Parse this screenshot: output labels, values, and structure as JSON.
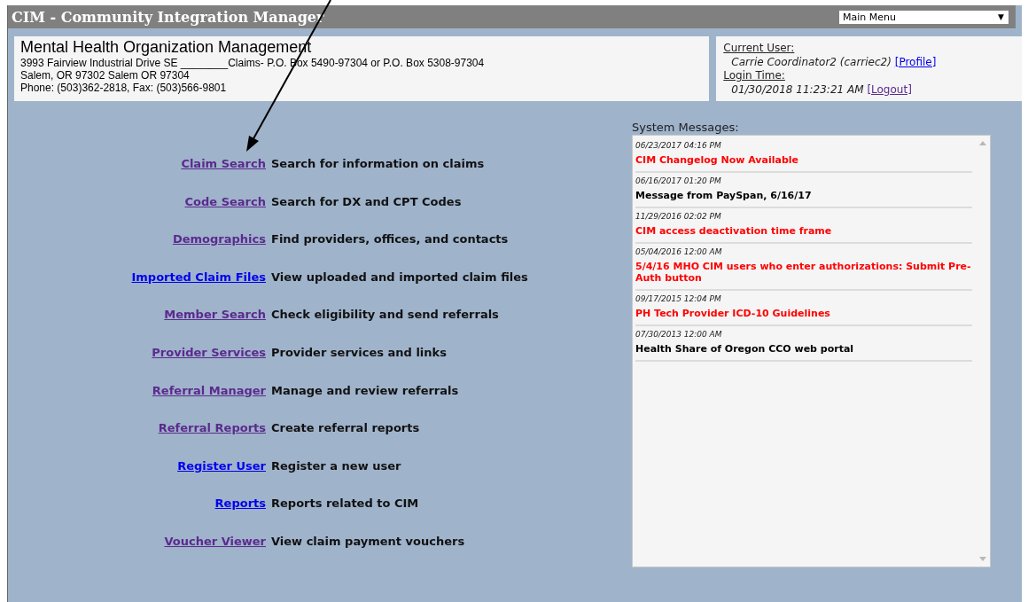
{
  "window": {
    "title": "CIM - Community Integration Manager"
  },
  "menu": {
    "value": "Main Menu",
    "arrow": "▼"
  },
  "organization": {
    "name": "Mental Health Organization Management",
    "address_lines": [
      "3993 Fairview Industrial Drive SE ________Claims- P.O. Box 5490-97304 or P.O. Box 5308-97304",
      "Salem, OR 97302 Salem OR 97304",
      "Phone: (503)362-2818, Fax: (503)566-9801"
    ]
  },
  "user": {
    "user_label": "Current User:",
    "user_name": "Carrie Coordinator2 (carriec2)",
    "profile_link": "[Profile]",
    "login_label": "Login Time:",
    "login_time": "01/30/2018 11:23:21 AM",
    "logout_link": "[Logout]"
  },
  "links": [
    {
      "label": "Claim Search",
      "description": "Search for information on claims",
      "visited": true
    },
    {
      "label": "Code Search",
      "description": "Search for DX and CPT Codes",
      "visited": true
    },
    {
      "label": "Demographics",
      "description": "Find providers, offices, and contacts",
      "visited": true
    },
    {
      "label": "Imported Claim Files",
      "description": "View uploaded and imported claim files",
      "visited": false
    },
    {
      "label": "Member Search",
      "description": "Check eligibility and send referrals",
      "visited": true
    },
    {
      "label": "Provider Services",
      "description": "Provider services and links",
      "visited": true
    },
    {
      "label": "Referral Manager",
      "description": "Manage and review referrals",
      "visited": true
    },
    {
      "label": "Referral Reports",
      "description": "Create referral reports",
      "visited": true
    },
    {
      "label": "Register User",
      "description": "Register a new user",
      "visited": false
    },
    {
      "label": "Reports",
      "description": "Reports related to CIM",
      "visited": false
    },
    {
      "label": "Voucher Viewer",
      "description": "View claim payment vouchers",
      "visited": true
    }
  ],
  "system_messages": {
    "title": "System Messages:",
    "items": [
      {
        "date": "06/23/2017 04:16 PM",
        "text": "CIM Changelog Now Available",
        "color": "#ff0000"
      },
      {
        "date": "06/16/2017 01:20 PM",
        "text": "Message from PaySpan, 6/16/17",
        "color": "#000000"
      },
      {
        "date": "11/29/2016 02:02 PM",
        "text": "CIM access deactivation time frame",
        "color": "#ff0000"
      },
      {
        "date": "05/04/2016 12:00 AM",
        "text": "5/4/16 MHO CIM users who enter authorizations: Submit Pre-Auth button",
        "color": "#ff0000"
      },
      {
        "date": "09/17/2015 12:04 PM",
        "text": "PH Tech Provider ICD-10 Guidelines",
        "color": "#ff0000"
      },
      {
        "date": "07/30/2013 12:00 AM",
        "text": "Health Share of Oregon CCO web portal",
        "color": "#000000"
      }
    ]
  }
}
